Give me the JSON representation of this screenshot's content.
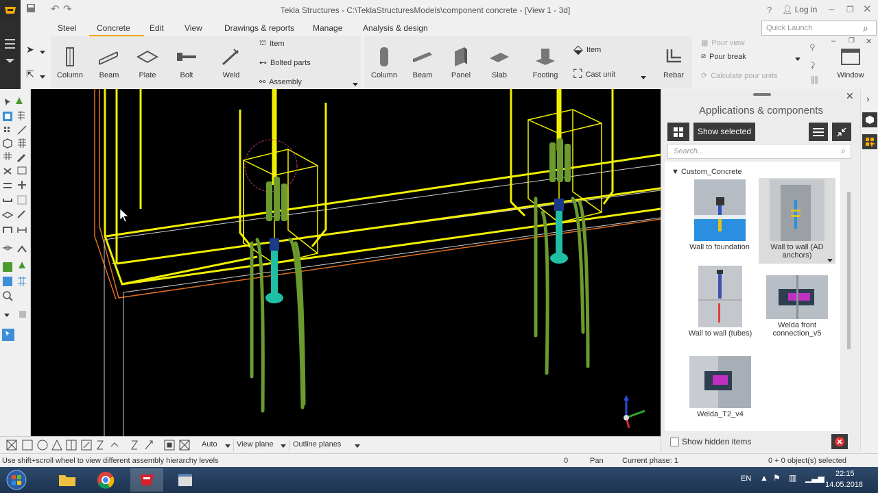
{
  "window": {
    "title": "Tekla Structures - C:\\TeklaStructuresModels\\component concrete  - [View 1 - 3d]",
    "help": "?",
    "login": "Log in"
  },
  "ribbon": {
    "tabs": [
      "Steel",
      "Concrete",
      "Edit",
      "View",
      "Drawings & reports",
      "Manage",
      "Analysis & design"
    ],
    "active_tab": "Concrete",
    "quick_launch_placeholder": "Quick Launch",
    "steel": {
      "column": "Column",
      "beam": "Beam",
      "plate": "Plate",
      "bolt": "Bolt",
      "weld": "Weld",
      "item": "Item",
      "bolted_parts": "Bolted parts",
      "assembly": "Assembly"
    },
    "concrete": {
      "column": "Column",
      "beam": "Beam",
      "panel": "Panel",
      "slab": "Slab",
      "footing": "Footing",
      "item": "Item",
      "cast_unit": "Cast unit",
      "rebar": "Rebar",
      "pour_view": "Pour view",
      "pour_break": "Pour break",
      "calculate_pour_units": "Calculate pour units",
      "window": "Window"
    }
  },
  "panel": {
    "title": "Applications & components",
    "show_selected": "Show selected",
    "search_placeholder": "Search...",
    "group": "Custom_Concrete",
    "items": [
      {
        "label": "Wall to foundation"
      },
      {
        "label": "Wall to wall (AD anchors)"
      },
      {
        "label": "Wall to wall (tubes)"
      },
      {
        "label": "Welda front connection_v5"
      },
      {
        "label": "Welda_T2_v4"
      }
    ],
    "show_hidden": "Show hidden items"
  },
  "bottom_toolbar": {
    "snap_mode": "Auto",
    "plane": "View plane",
    "outline": "Outline planes"
  },
  "status": {
    "hint": "Use shift+scroll wheel to view different assembly hierarchy levels",
    "count": "0",
    "mode": "Pan",
    "phase": "Current phase: 1",
    "selected": "0 + 0 object(s) selected"
  },
  "taskbar": {
    "lang": "EN",
    "time": "22:15",
    "date": "14.05.2018"
  },
  "colors": {
    "accent": "#f5a800",
    "rebar_yellow": "#f0f000",
    "rebar_green": "#6b9a2e",
    "anchor_teal": "#1fbfa6",
    "outline_orange": "#e07020"
  }
}
